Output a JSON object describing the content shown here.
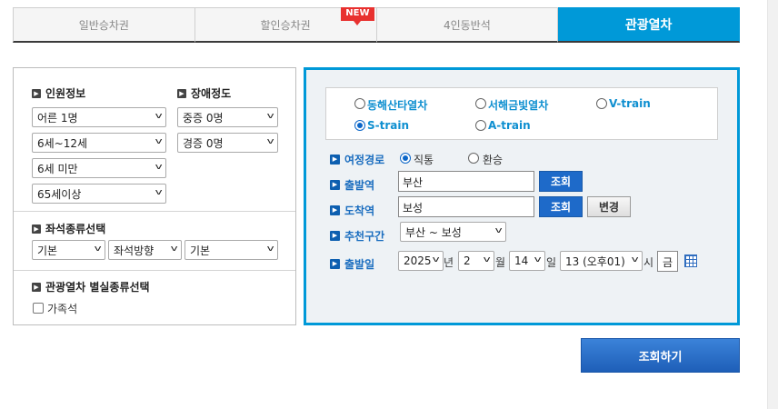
{
  "tabs": [
    {
      "label": "일반승차권",
      "active": false
    },
    {
      "label": "할인승차권",
      "active": false,
      "badge": "NEW"
    },
    {
      "label": "4인동반석",
      "active": false
    },
    {
      "label": "관광열차",
      "active": true
    }
  ],
  "passenger": {
    "title": "인원정보",
    "selects": [
      "어른 1명",
      "6세~12세",
      "6세 미만",
      "65세이상"
    ]
  },
  "disability": {
    "title": "장애정도",
    "selects": [
      "중증 0명",
      "경증 0명"
    ]
  },
  "seat_type": {
    "title": "좌석종류선택",
    "selects": [
      "기본",
      "좌석방향",
      "기본"
    ]
  },
  "special_room": {
    "title": "관광열차 별실종류선택",
    "checkbox_label": "가족석",
    "checked": false
  },
  "trains": {
    "options": [
      "동해산타열차",
      "서해금빛열차",
      "V-train",
      "S-train",
      "A-train"
    ],
    "selected": "S-train"
  },
  "route": {
    "trip_label": "여정경로",
    "trip_options": [
      "직통",
      "환승"
    ],
    "trip_selected": "직통",
    "departure_label": "출발역",
    "departure_value": "부산",
    "arrival_label": "도착역",
    "arrival_value": "보성",
    "lookup_label": "조회",
    "change_label": "변경",
    "recommend_label": "추천구간",
    "recommend_value": "부산 ~ 보성",
    "date_label": "출발일",
    "year": "2025",
    "year_unit": "년",
    "month": "2",
    "month_unit": "월",
    "day": "14",
    "day_unit": "일",
    "hour": "13 (오후01)",
    "hour_unit": "시",
    "weekday": "금"
  },
  "search_button": "조회하기",
  "colors": {
    "accent": "#0099d8",
    "button_blue": "#1e6ac9",
    "badge_red": "#e8312f"
  }
}
